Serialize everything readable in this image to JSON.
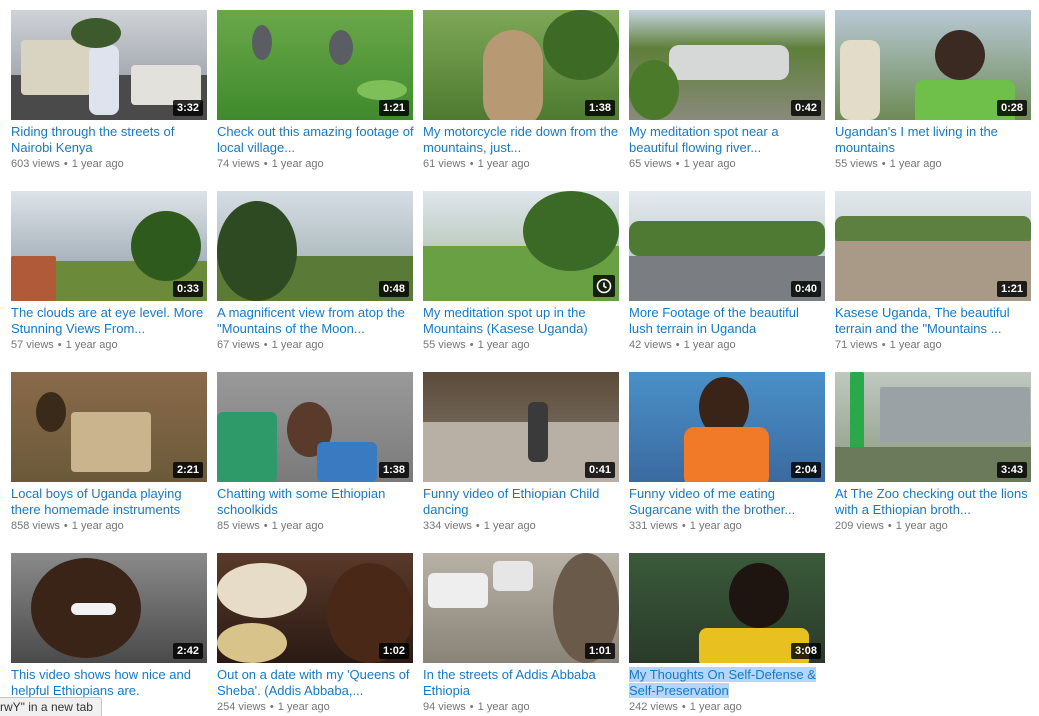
{
  "status_bar": {
    "text": "rwY\" in a new tab"
  },
  "videos": [
    {
      "title": "Riding through the streets of Nairobi Kenya",
      "title_display": "Riding through the streets of Nairobi Kenya",
      "duration": "3:32",
      "views": "603 views",
      "age": "1 year ago"
    },
    {
      "title": "Check out this amazing footage of local village...",
      "title_display": "Check out this amazing footage of local village...",
      "duration": "1:21",
      "views": "74 views",
      "age": "1 year ago"
    },
    {
      "title": "My motorcycle ride down from the mountains, just...",
      "title_display": "My motorcycle ride down from the mountains, just...",
      "duration": "1:38",
      "views": "61 views",
      "age": "1 year ago"
    },
    {
      "title": "My meditation spot near a beautiful flowing river...",
      "title_display": "My meditation spot near a beautiful flowing river...",
      "duration": "0:42",
      "views": "65 views",
      "age": "1 year ago"
    },
    {
      "title": "Ugandan's I met living in the mountains",
      "title_display": "Ugandan's I met living in the mountains",
      "duration": "0:28",
      "views": "55 views",
      "age": "1 year ago"
    },
    {
      "title": "The clouds are at eye level. More Stunning Views From...",
      "title_display": "The clouds are at eye level. More Stunning Views From...",
      "duration": "0:33",
      "views": "57 views",
      "age": "1 year ago"
    },
    {
      "title": "A magnificent view from atop the \"Mountains of the Moon...",
      "title_display": "A magnificent view from atop the \"Mountains of the Moon...",
      "duration": "0:48",
      "views": "67 views",
      "age": "1 year ago"
    },
    {
      "title": "My meditation spot up in the Mountains (Kasese Uganda)",
      "title_display": "My meditation spot up in the Mountains (Kasese Uganda)",
      "duration": "",
      "views": "55 views",
      "age": "1 year ago"
    },
    {
      "title": "More Footage of the beautiful lush terrain in Uganda",
      "title_display": "More Footage of the beautiful lush terrain in Uganda",
      "duration": "0:40",
      "views": "42 views",
      "age": "1 year ago"
    },
    {
      "title": "Kasese Uganda, The beautiful terrain and the \"Mountains ...",
      "title_display": "Kasese Uganda, The beautiful terrain and the \"Mountains ...",
      "duration": "1:21",
      "views": "71 views",
      "age": "1 year ago"
    },
    {
      "title": "Local boys of Uganda playing there homemade instruments",
      "title_display": "Local boys of Uganda playing there homemade instruments",
      "duration": "2:21",
      "views": "858 views",
      "age": "1 year ago"
    },
    {
      "title": "Chatting with some Ethiopian schoolkids",
      "title_display": "Chatting with some Ethiopian schoolkids",
      "duration": "1:38",
      "views": "85 views",
      "age": "1 year ago"
    },
    {
      "title": "Funny video of Ethiopian Child dancing",
      "title_display": "Funny video of Ethiopian Child dancing",
      "duration": "0:41",
      "views": "334 views",
      "age": "1 year ago"
    },
    {
      "title": "Funny video of me eating Sugarcane with the brother...",
      "title_display": "Funny video of me eating Sugarcane with the brother...",
      "duration": "2:04",
      "views": "331 views",
      "age": "1 year ago"
    },
    {
      "title": "At The Zoo checking out the lions with a Ethiopian broth...",
      "title_display": "At The Zoo checking out the lions with a Ethiopian broth...",
      "duration": "3:43",
      "views": "209 views",
      "age": "1 year ago"
    },
    {
      "title": "This video shows how nice and helpful Ethiopians are.",
      "title_display": "This video shows how nice and helpful Ethiopians are.",
      "duration": "2:42",
      "views": "",
      "age": "ago"
    },
    {
      "title": "Out on a date with my 'Queens of Sheba'. (Addis Abbaba,...",
      "title_display": "Out on a date with my 'Queens of Sheba'. (Addis Abbaba,...",
      "duration": "1:02",
      "views": "254 views",
      "age": "1 year ago"
    },
    {
      "title": "In the streets of Addis Abbaba Ethiopia",
      "title_display": "In the streets of Addis Abbaba Ethiopia",
      "duration": "1:01",
      "views": "94 views",
      "age": "1 year ago"
    },
    {
      "title": "My Thoughts On Self-Defense & Self-Preservation",
      "title_display": "My Thoughts On Self-Defense & Self-Preservation",
      "duration": "3:08",
      "views": "242 views",
      "age": "1 year ago"
    }
  ],
  "colors": {
    "link": "#167ac6",
    "meta": "#767676",
    "selection": "#b5d5fb",
    "duration_bg": "#000000"
  },
  "icons": {
    "watch_later": "clock-icon"
  }
}
